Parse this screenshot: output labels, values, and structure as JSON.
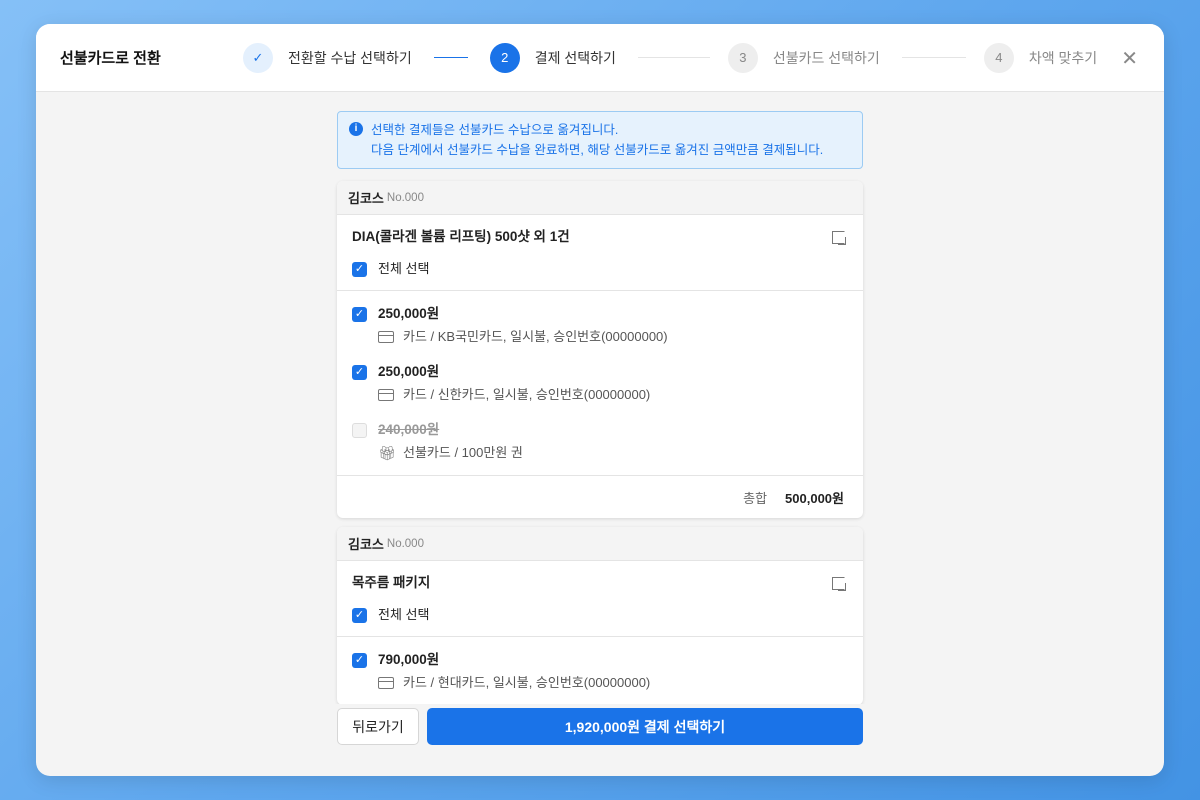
{
  "header": {
    "title": "선불카드로 전환",
    "close_icon": "close-icon",
    "steps": [
      {
        "num": "✓",
        "label": "전환할 수납 선택하기",
        "state": "done"
      },
      {
        "num": "2",
        "label": "결제 선택하기",
        "state": "active"
      },
      {
        "num": "3",
        "label": "선불카드 선택하기",
        "state": "pending"
      },
      {
        "num": "4",
        "label": "차액 맞추기",
        "state": "pending"
      }
    ]
  },
  "info": {
    "line1": "선택한 결제들은 선불카드 수납으로 옮겨집니다.",
    "line2": "다음 단계에서 선불카드 수납을 완료하면, 해당 선불카드로 옮겨진 금액만큼 결제됩니다."
  },
  "cards": [
    {
      "customer": "김코스",
      "no": "No.000",
      "product": "DIA(콜라겐 볼륨 리프팅) 500샷 외 1건",
      "select_all": "전체 선택",
      "items": [
        {
          "amount": "250,000원",
          "detail": "카드 / KB국민카드, 일시불, 승인번호(00000000)",
          "checked": true
        },
        {
          "amount": "250,000원",
          "detail": "카드 / 신한카드, 일시불, 승인번호(00000000)",
          "checked": true
        },
        {
          "amount": "240,000원",
          "detail": "선불카드 / 100만원 권",
          "checked": false
        }
      ],
      "total_label": "총합",
      "total": "500,000원"
    },
    {
      "customer": "김코스",
      "no": "No.000",
      "product": "목주름 패키지",
      "select_all": "전체 선택",
      "items": [
        {
          "amount": "790,000원",
          "detail": "카드 / 현대카드, 일시불, 승인번호(00000000)",
          "checked": true
        }
      ]
    }
  ],
  "footer": {
    "back": "뒤로가기",
    "submit": "1,920,000원 결제 선택하기"
  },
  "colors": {
    "accent": "#1a73e8"
  }
}
